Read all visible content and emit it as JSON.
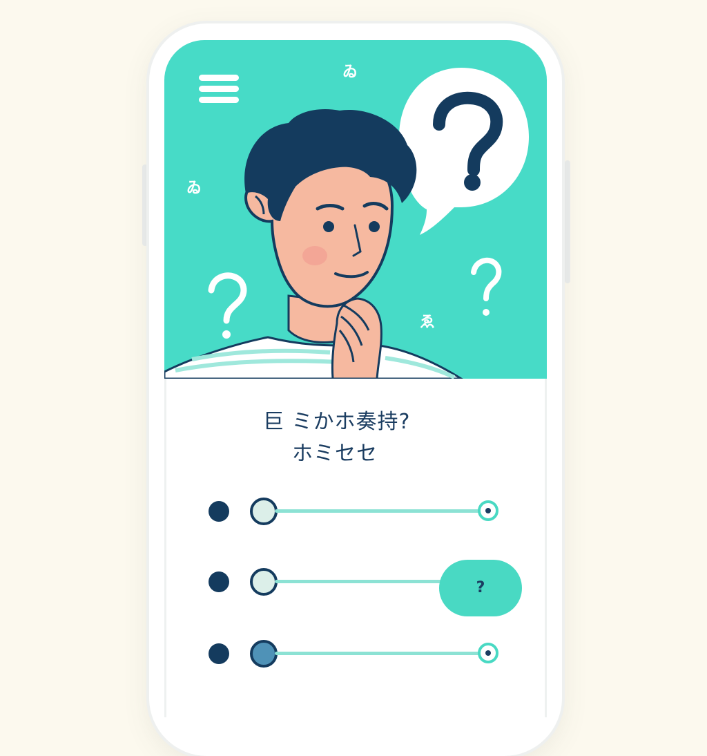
{
  "app": {
    "menu_icon": "hamburger-menu-icon",
    "hero_glyphs": [
      "ゐ",
      "ゐ",
      "ゑ"
    ],
    "bubble_mark": "?",
    "floating_marks": [
      "?",
      "?"
    ]
  },
  "quiz": {
    "question_line1": "巨 ミかホ奏持?",
    "question_line2": "ホミセセ",
    "hint_label": "?"
  },
  "colors": {
    "hero_bg": "#47dbc7",
    "accent": "#49d9c3",
    "ink": "#1b3d61",
    "page_bg": "#fcf9ee"
  },
  "options": [
    {
      "state": "unselected",
      "icon": "radio-icon"
    },
    {
      "state": "unselected",
      "icon": "radio-icon"
    },
    {
      "state": "selected",
      "icon": "radio-icon"
    }
  ]
}
